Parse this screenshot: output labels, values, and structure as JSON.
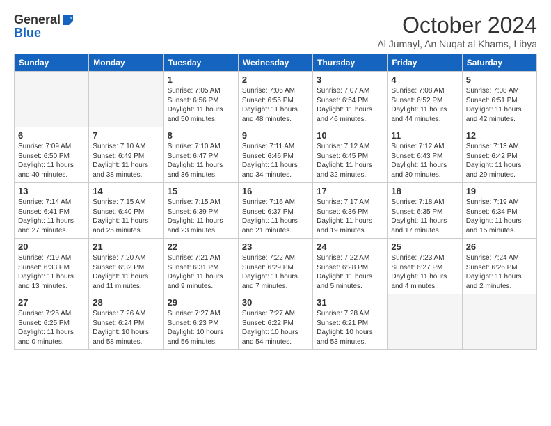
{
  "logo": {
    "line1": "General",
    "line2": "Blue"
  },
  "header": {
    "month": "October 2024",
    "location": "Al Jumayl, An Nuqat al Khams, Libya"
  },
  "days_of_week": [
    "Sunday",
    "Monday",
    "Tuesday",
    "Wednesday",
    "Thursday",
    "Friday",
    "Saturday"
  ],
  "weeks": [
    [
      {
        "day": "",
        "empty": true
      },
      {
        "day": "",
        "empty": true
      },
      {
        "day": "1",
        "sunrise": "Sunrise: 7:05 AM",
        "sunset": "Sunset: 6:56 PM",
        "daylight": "Daylight: 11 hours and 50 minutes."
      },
      {
        "day": "2",
        "sunrise": "Sunrise: 7:06 AM",
        "sunset": "Sunset: 6:55 PM",
        "daylight": "Daylight: 11 hours and 48 minutes."
      },
      {
        "day": "3",
        "sunrise": "Sunrise: 7:07 AM",
        "sunset": "Sunset: 6:54 PM",
        "daylight": "Daylight: 11 hours and 46 minutes."
      },
      {
        "day": "4",
        "sunrise": "Sunrise: 7:08 AM",
        "sunset": "Sunset: 6:52 PM",
        "daylight": "Daylight: 11 hours and 44 minutes."
      },
      {
        "day": "5",
        "sunrise": "Sunrise: 7:08 AM",
        "sunset": "Sunset: 6:51 PM",
        "daylight": "Daylight: 11 hours and 42 minutes."
      }
    ],
    [
      {
        "day": "6",
        "sunrise": "Sunrise: 7:09 AM",
        "sunset": "Sunset: 6:50 PM",
        "daylight": "Daylight: 11 hours and 40 minutes."
      },
      {
        "day": "7",
        "sunrise": "Sunrise: 7:10 AM",
        "sunset": "Sunset: 6:49 PM",
        "daylight": "Daylight: 11 hours and 38 minutes."
      },
      {
        "day": "8",
        "sunrise": "Sunrise: 7:10 AM",
        "sunset": "Sunset: 6:47 PM",
        "daylight": "Daylight: 11 hours and 36 minutes."
      },
      {
        "day": "9",
        "sunrise": "Sunrise: 7:11 AM",
        "sunset": "Sunset: 6:46 PM",
        "daylight": "Daylight: 11 hours and 34 minutes."
      },
      {
        "day": "10",
        "sunrise": "Sunrise: 7:12 AM",
        "sunset": "Sunset: 6:45 PM",
        "daylight": "Daylight: 11 hours and 32 minutes."
      },
      {
        "day": "11",
        "sunrise": "Sunrise: 7:12 AM",
        "sunset": "Sunset: 6:43 PM",
        "daylight": "Daylight: 11 hours and 30 minutes."
      },
      {
        "day": "12",
        "sunrise": "Sunrise: 7:13 AM",
        "sunset": "Sunset: 6:42 PM",
        "daylight": "Daylight: 11 hours and 29 minutes."
      }
    ],
    [
      {
        "day": "13",
        "sunrise": "Sunrise: 7:14 AM",
        "sunset": "Sunset: 6:41 PM",
        "daylight": "Daylight: 11 hours and 27 minutes."
      },
      {
        "day": "14",
        "sunrise": "Sunrise: 7:15 AM",
        "sunset": "Sunset: 6:40 PM",
        "daylight": "Daylight: 11 hours and 25 minutes."
      },
      {
        "day": "15",
        "sunrise": "Sunrise: 7:15 AM",
        "sunset": "Sunset: 6:39 PM",
        "daylight": "Daylight: 11 hours and 23 minutes."
      },
      {
        "day": "16",
        "sunrise": "Sunrise: 7:16 AM",
        "sunset": "Sunset: 6:37 PM",
        "daylight": "Daylight: 11 hours and 21 minutes."
      },
      {
        "day": "17",
        "sunrise": "Sunrise: 7:17 AM",
        "sunset": "Sunset: 6:36 PM",
        "daylight": "Daylight: 11 hours and 19 minutes."
      },
      {
        "day": "18",
        "sunrise": "Sunrise: 7:18 AM",
        "sunset": "Sunset: 6:35 PM",
        "daylight": "Daylight: 11 hours and 17 minutes."
      },
      {
        "day": "19",
        "sunrise": "Sunrise: 7:19 AM",
        "sunset": "Sunset: 6:34 PM",
        "daylight": "Daylight: 11 hours and 15 minutes."
      }
    ],
    [
      {
        "day": "20",
        "sunrise": "Sunrise: 7:19 AM",
        "sunset": "Sunset: 6:33 PM",
        "daylight": "Daylight: 11 hours and 13 minutes."
      },
      {
        "day": "21",
        "sunrise": "Sunrise: 7:20 AM",
        "sunset": "Sunset: 6:32 PM",
        "daylight": "Daylight: 11 hours and 11 minutes."
      },
      {
        "day": "22",
        "sunrise": "Sunrise: 7:21 AM",
        "sunset": "Sunset: 6:31 PM",
        "daylight": "Daylight: 11 hours and 9 minutes."
      },
      {
        "day": "23",
        "sunrise": "Sunrise: 7:22 AM",
        "sunset": "Sunset: 6:29 PM",
        "daylight": "Daylight: 11 hours and 7 minutes."
      },
      {
        "day": "24",
        "sunrise": "Sunrise: 7:22 AM",
        "sunset": "Sunset: 6:28 PM",
        "daylight": "Daylight: 11 hours and 5 minutes."
      },
      {
        "day": "25",
        "sunrise": "Sunrise: 7:23 AM",
        "sunset": "Sunset: 6:27 PM",
        "daylight": "Daylight: 11 hours and 4 minutes."
      },
      {
        "day": "26",
        "sunrise": "Sunrise: 7:24 AM",
        "sunset": "Sunset: 6:26 PM",
        "daylight": "Daylight: 11 hours and 2 minutes."
      }
    ],
    [
      {
        "day": "27",
        "sunrise": "Sunrise: 7:25 AM",
        "sunset": "Sunset: 6:25 PM",
        "daylight": "Daylight: 11 hours and 0 minutes."
      },
      {
        "day": "28",
        "sunrise": "Sunrise: 7:26 AM",
        "sunset": "Sunset: 6:24 PM",
        "daylight": "Daylight: 10 hours and 58 minutes."
      },
      {
        "day": "29",
        "sunrise": "Sunrise: 7:27 AM",
        "sunset": "Sunset: 6:23 PM",
        "daylight": "Daylight: 10 hours and 56 minutes."
      },
      {
        "day": "30",
        "sunrise": "Sunrise: 7:27 AM",
        "sunset": "Sunset: 6:22 PM",
        "daylight": "Daylight: 10 hours and 54 minutes."
      },
      {
        "day": "31",
        "sunrise": "Sunrise: 7:28 AM",
        "sunset": "Sunset: 6:21 PM",
        "daylight": "Daylight: 10 hours and 53 minutes."
      },
      {
        "day": "",
        "empty": true
      },
      {
        "day": "",
        "empty": true
      }
    ]
  ]
}
